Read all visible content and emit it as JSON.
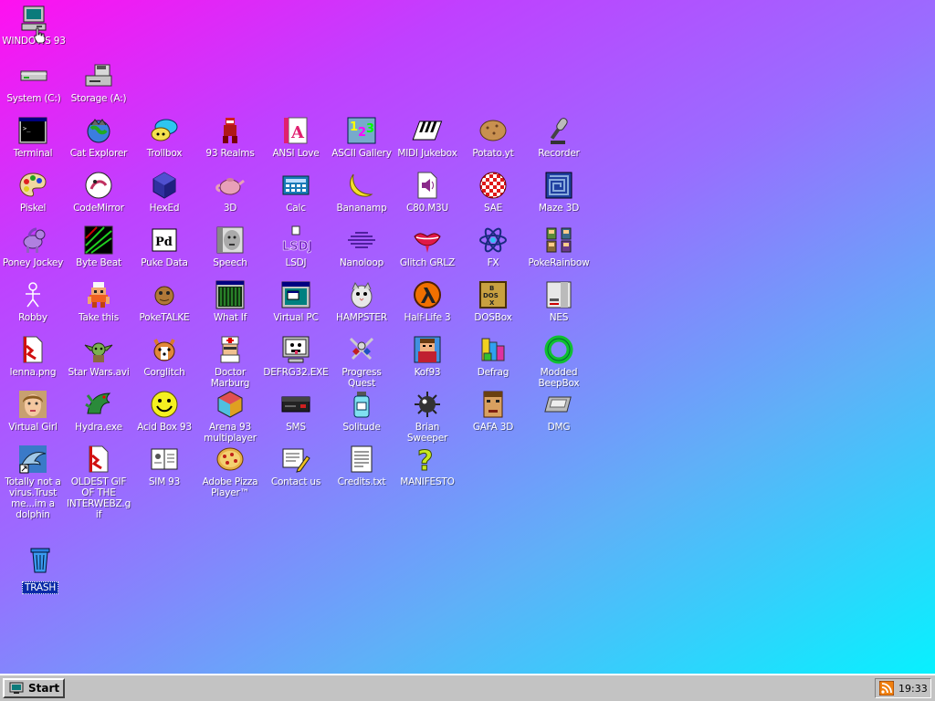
{
  "desktop": {
    "icons": [
      {
        "label": "WINDOWS 93",
        "icon": "computer-icon"
      },
      {
        "label": "System (C:)",
        "icon": "drive-icon"
      },
      {
        "label": "Storage (A:)",
        "icon": "floppy-drive-icon"
      },
      {
        "label": "Terminal",
        "icon": "terminal-icon"
      },
      {
        "label": "Cat Explorer",
        "icon": "cat-explorer-icon"
      },
      {
        "label": "Trollbox",
        "icon": "chat-bubble-icon"
      },
      {
        "label": "93 Realms",
        "icon": "knight-icon"
      },
      {
        "label": "ANSI Love",
        "icon": "ansi-letter-icon"
      },
      {
        "label": "ASCII Gallery",
        "icon": "ascii-123-icon"
      },
      {
        "label": "MIDI Jukebox",
        "icon": "piano-keys-icon"
      },
      {
        "label": "Potato.yt",
        "icon": "potato-icon"
      },
      {
        "label": "Recorder",
        "icon": "microphone-icon"
      },
      {
        "label": "Piskel",
        "icon": "paint-palette-icon"
      },
      {
        "label": "CodeMirror",
        "icon": "codemirror-icon"
      },
      {
        "label": "HexEd",
        "icon": "cube-icon"
      },
      {
        "label": "3D",
        "icon": "teapot-icon"
      },
      {
        "label": "Calc",
        "icon": "calculator-icon"
      },
      {
        "label": "Bananamp",
        "icon": "banana-icon"
      },
      {
        "label": "C80.M3U",
        "icon": "speaker-file-icon"
      },
      {
        "label": "SAE",
        "icon": "checkered-ball-icon"
      },
      {
        "label": "Maze 3D",
        "icon": "maze-icon"
      },
      {
        "label": "Poney Jockey",
        "icon": "pony-icon"
      },
      {
        "label": "Byte Beat",
        "icon": "bytebeat-icon"
      },
      {
        "label": "Puke Data",
        "icon": "pd-icon"
      },
      {
        "label": "Speech",
        "icon": "face-speech-icon"
      },
      {
        "label": "LSDJ",
        "icon": "lsdj-icon"
      },
      {
        "label": "Nanoloop",
        "icon": "wave-icon"
      },
      {
        "label": "Glitch GRLZ",
        "icon": "lips-icon"
      },
      {
        "label": "FX",
        "icon": "atom-icon"
      },
      {
        "label": "PokeRainbow",
        "icon": "characters-icon"
      },
      {
        "label": "Robby",
        "icon": "stick-figure-icon"
      },
      {
        "label": "Take this",
        "icon": "dwarf-icon"
      },
      {
        "label": "PokeTALKE",
        "icon": "pokemon-icon"
      },
      {
        "label": "What If",
        "icon": "grid-window-icon"
      },
      {
        "label": "Virtual PC",
        "icon": "window-pc-icon"
      },
      {
        "label": "HAMPSTER",
        "icon": "hamster-icon"
      },
      {
        "label": "Half-Life 3",
        "icon": "lambda-icon"
      },
      {
        "label": "DOSBox",
        "icon": "dosbox-icon"
      },
      {
        "label": "NES",
        "icon": "nes-console-icon"
      },
      {
        "label": "lenna.png",
        "icon": "image-file-icon"
      },
      {
        "label": "Star Wars.avi",
        "icon": "yoda-icon"
      },
      {
        "label": "Corglitch",
        "icon": "corgi-icon"
      },
      {
        "label": "Doctor Marburg",
        "icon": "doctor-icon"
      },
      {
        "label": "DEFRG32.EXE",
        "icon": "monitor-face-icon"
      },
      {
        "label": "Progress Quest",
        "icon": "crossed-swords-icon"
      },
      {
        "label": "Kof93",
        "icon": "fighter-icon"
      },
      {
        "label": "Defrag",
        "icon": "defrag-icon"
      },
      {
        "label": "Modded BeepBox",
        "icon": "green-ring-icon"
      },
      {
        "label": "Virtual Girl",
        "icon": "girl-face-icon"
      },
      {
        "label": "Hydra.exe",
        "icon": "dragon-icon"
      },
      {
        "label": "Acid Box 93",
        "icon": "smiley-icon"
      },
      {
        "label": "Arena 93 multiplayer",
        "icon": "color-cube-icon"
      },
      {
        "label": "SMS",
        "icon": "sega-console-icon"
      },
      {
        "label": "Solitude",
        "icon": "jar-icon"
      },
      {
        "label": "Brian Sweeper",
        "icon": "mine-icon"
      },
      {
        "label": "GAFA 3D",
        "icon": "doomguy-icon"
      },
      {
        "label": "DMG",
        "icon": "gameboy-cart-icon"
      },
      {
        "label": "Totally not a virus.Trust me...im a dolphin",
        "icon": "dolphin-icon"
      },
      {
        "label": "OLDEST GIF OF THE INTERWEBZ.gif",
        "icon": "gif-file-icon"
      },
      {
        "label": "SIM 93",
        "icon": "book-icon"
      },
      {
        "label": "Adobe Pizza Player™",
        "icon": "pizza-icon"
      },
      {
        "label": "Contact us",
        "icon": "contact-icon"
      },
      {
        "label": "Credits.txt",
        "icon": "text-file-icon"
      },
      {
        "label": "MANIFESTO",
        "icon": "question-mark-icon"
      },
      {
        "label": "TRASH",
        "icon": "trash-icon"
      }
    ]
  },
  "taskbar": {
    "start_label": "Start",
    "clock": "19:33",
    "tray_icon": "rss-icon"
  },
  "colors": {
    "gradient_top_left": "#ff10f0",
    "gradient_bottom_right": "#00f6ff",
    "taskbar": "#c3c3c3",
    "trash_selection": "#0a2aa8"
  }
}
